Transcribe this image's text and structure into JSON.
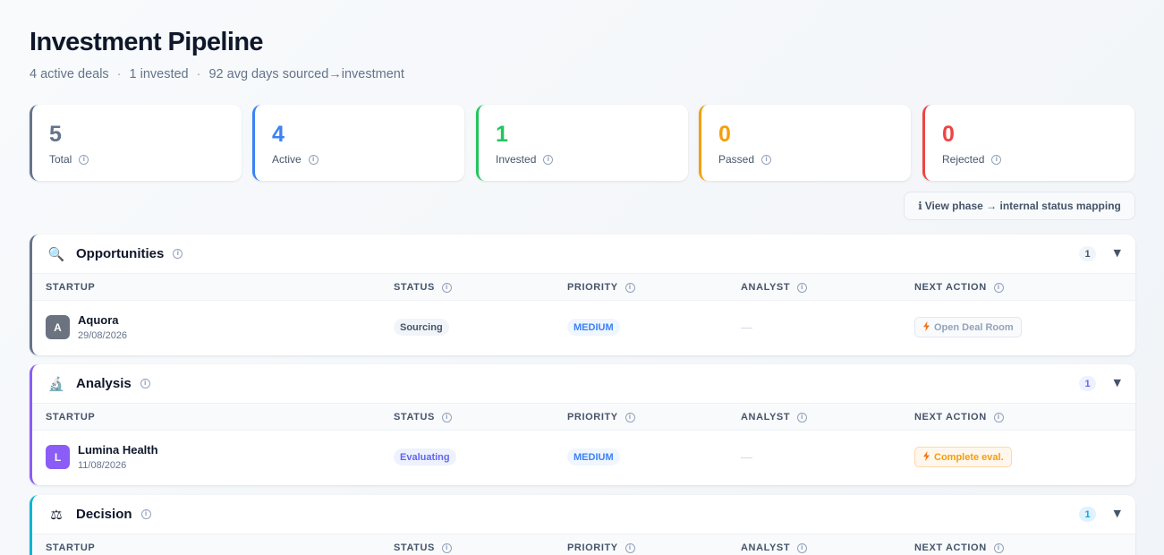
{
  "header": {
    "title": "Investment Pipeline",
    "subtitle_parts": [
      "4 active deals",
      "1 invested",
      "92 avg days sourced→investment"
    ],
    "separator": "·"
  },
  "stats": [
    {
      "value": "5",
      "label": "Total",
      "color": "#64748b"
    },
    {
      "value": "4",
      "label": "Active",
      "color": "#3b82f6"
    },
    {
      "value": "1",
      "label": "Invested",
      "color": "#22c55e"
    },
    {
      "value": "0",
      "label": "Passed",
      "color": "#f59e0b"
    },
    {
      "value": "0",
      "label": "Rejected",
      "color": "#ef4444"
    }
  ],
  "mapping_button": {
    "icon": "ℹ",
    "label": "View phase → internal status mapping"
  },
  "columns": [
    "STARTUP",
    "STATUS",
    "PRIORITY",
    "ANALYST",
    "NEXT ACTION"
  ],
  "info_glyph": "i",
  "chevron": "▼",
  "phases": [
    {
      "name": "Opportunities",
      "icon": "magnifier-icon",
      "icon_glyph": "🔍",
      "accent": "#64748b",
      "count": "1",
      "count_bg": "#f1f5f9",
      "count_color": "#475569",
      "rows": [
        {
          "avatar": "A",
          "avatar_color": "#6b7280",
          "name": "Aquora",
          "date": "29/08/2026",
          "status": "Sourcing",
          "status_bg": "#f1f5f9",
          "status_color": "#475569",
          "priority": "MEDIUM",
          "analyst": "—",
          "action": "Open Deal Room",
          "action_bg": "#f8fafc",
          "action_color": "#94a3b8",
          "action_border": "#e2e8f0"
        }
      ]
    },
    {
      "name": "Analysis",
      "icon": "microscope-icon",
      "icon_glyph": "🔬",
      "accent": "#8b5cf6",
      "count": "1",
      "count_bg": "#eef2ff",
      "count_color": "#6366f1",
      "rows": [
        {
          "avatar": "L",
          "avatar_color": "#8b5cf6",
          "name": "Lumina Health",
          "date": "11/08/2026",
          "status": "Evaluating",
          "status_bg": "#eef2ff",
          "status_color": "#6366f1",
          "priority": "MEDIUM",
          "analyst": "—",
          "action": "Complete eval.",
          "action_bg": "#fff7ed",
          "action_color": "#f59e0b",
          "action_border": "#fed7aa"
        }
      ]
    },
    {
      "name": "Decision",
      "icon": "scales-icon",
      "icon_glyph": "⚖",
      "accent": "#06b6d4",
      "count": "1",
      "count_bg": "#e0f2fe",
      "count_color": "#0ea5e9",
      "rows": []
    }
  ]
}
